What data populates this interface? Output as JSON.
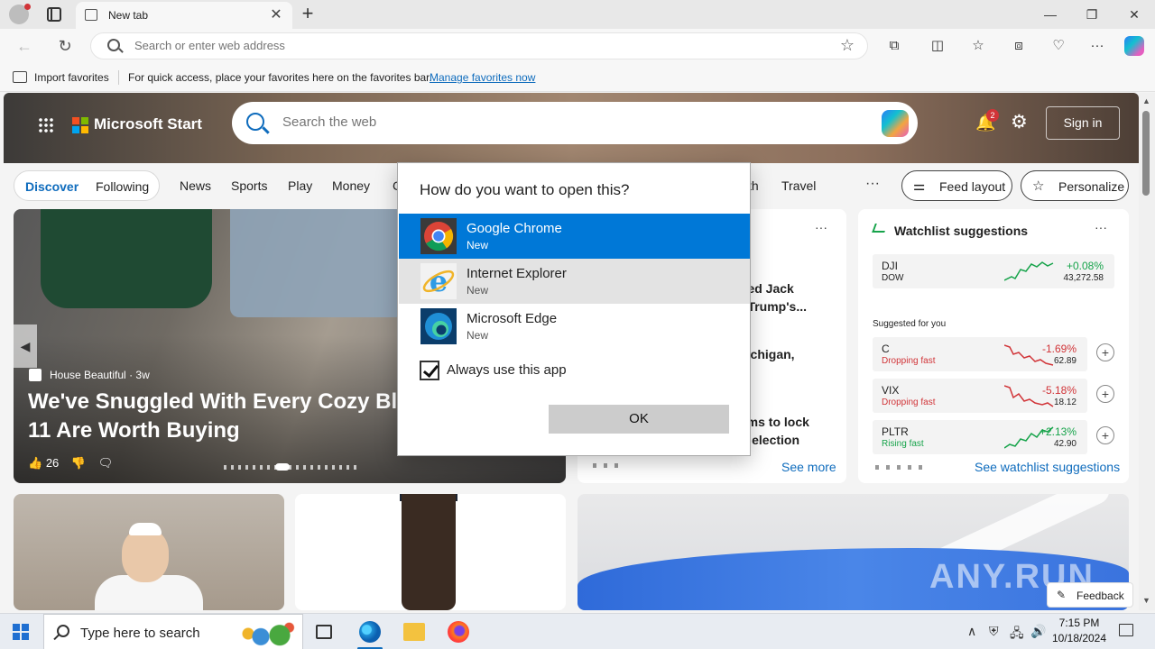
{
  "browser": {
    "tab_title": "New tab",
    "address_placeholder": "Search or enter web address",
    "favorites_bar": {
      "import_label": "Import favorites",
      "message": "For quick access, place your favorites here on the favorites bar.",
      "manage_link": "Manage favorites now"
    }
  },
  "msn": {
    "brand": "Microsoft Start",
    "search_placeholder": "Search the web",
    "notification_count": "2",
    "sign_in": "Sign in",
    "nav": {
      "discover": "Discover",
      "following": "Following",
      "categories": [
        "News",
        "Sports",
        "Play",
        "Money",
        "C",
        "th",
        "Travel"
      ],
      "more": "···",
      "feed_layout": "Feed layout",
      "personalize": "Personalize"
    },
    "hero_article": {
      "source": "House Beautiful",
      "age": "3w",
      "headline": "We've Snuggled With Every Cozy Blan and These 11 Are Worth Buying",
      "likes": "26"
    },
    "news_card": {
      "fragments": [
        "cted Jack",
        "d Trump's...",
        "Michigan,",
        "aims to lock",
        "S. election"
      ],
      "see_more": "See more"
    },
    "watchlist": {
      "title": "Watchlist suggestions",
      "pinned": [
        {
          "symbol": "DJI",
          "name": "DOW",
          "change": "+0.08%",
          "price": "43,272.58",
          "trend": "up"
        }
      ],
      "suggested_label": "Suggested for you",
      "suggested": [
        {
          "symbol": "C",
          "status": "Dropping fast",
          "change": "-1.69%",
          "price": "62.89",
          "trend": "down"
        },
        {
          "symbol": "VIX",
          "status": "Dropping fast",
          "change": "-5.18%",
          "price": "18.12",
          "trend": "down"
        },
        {
          "symbol": "PLTR",
          "status": "Rising fast",
          "change": "+2.13%",
          "price": "42.90",
          "trend": "up"
        }
      ],
      "see_more": "See watchlist suggestions",
      "colors": {
        "up": "#16a34a",
        "down": "#d13438"
      }
    },
    "feedback": "Feedback",
    "watermark": "ANY.RUN"
  },
  "dialog": {
    "title": "How do you want to open this?",
    "apps": [
      {
        "name": "Google Chrome",
        "sub": "New",
        "icon": "chrome-icon",
        "state": "selected"
      },
      {
        "name": "Internet Explorer",
        "sub": "New",
        "icon": "internet-explorer-icon",
        "state": "hover"
      },
      {
        "name": "Microsoft Edge",
        "sub": "New",
        "icon": "edge-icon",
        "state": "normal"
      }
    ],
    "always_use_label": "Always use this app",
    "always_use_checked": true,
    "ok_label": "OK",
    "accent_color": "#0078d7"
  },
  "taskbar": {
    "search_placeholder": "Type here to search",
    "time": "7:15 PM",
    "date": "10/18/2024"
  }
}
